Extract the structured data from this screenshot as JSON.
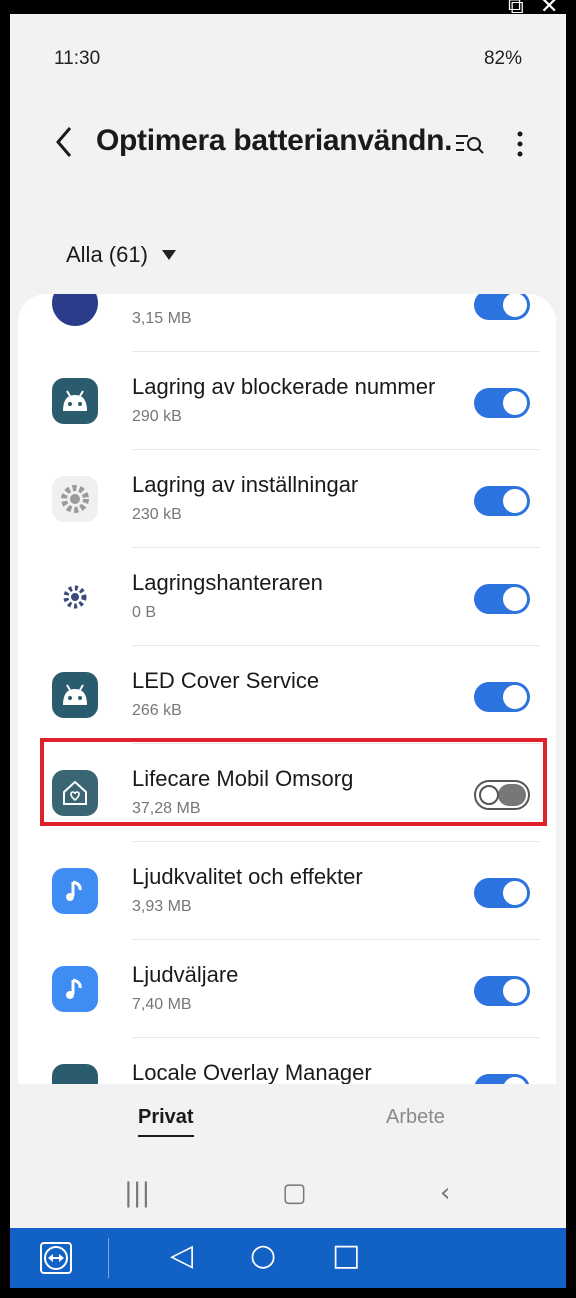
{
  "status_bar": {
    "time": "11:30",
    "right": "82%"
  },
  "header": {
    "title": "Optimera batterianvändn."
  },
  "filter": {
    "label": "Alla (61)"
  },
  "apps": [
    {
      "name": "",
      "size": "3,15 MB",
      "enabled": true,
      "icon": "android-app-icon"
    },
    {
      "name": "Lagring av blockerade nummer",
      "size": "290 kB",
      "enabled": true,
      "icon": "android-app-icon"
    },
    {
      "name": "Lagring av inställningar",
      "size": "230 kB",
      "enabled": true,
      "icon": "gear-icon"
    },
    {
      "name": "Lagringshanteraren",
      "size": "0 B",
      "enabled": true,
      "icon": "gear-icon"
    },
    {
      "name": "LED Cover Service",
      "size": "266 kB",
      "enabled": true,
      "icon": "android-app-icon"
    },
    {
      "name": "Lifecare Mobil Omsorg",
      "size": "37,28 MB",
      "enabled": false,
      "icon": "home-heart-icon"
    },
    {
      "name": "Ljudkvalitet och effekter",
      "size": "3,93 MB",
      "enabled": true,
      "icon": "music-note-icon"
    },
    {
      "name": "Ljudväljare",
      "size": "7,40 MB",
      "enabled": true,
      "icon": "music-note-icon"
    },
    {
      "name": "Locale Overlay Manager",
      "size": "",
      "enabled": true,
      "icon": "android-app-icon"
    }
  ],
  "tabs": {
    "private": "Privat",
    "work": "Arbete"
  },
  "colors": {
    "toggle_on": "#2c73e0",
    "highlight": "#e0202a",
    "android_icon": "#2b5b6e",
    "music_icon": "#3f8cf3",
    "remote_bar": "#1262c6"
  }
}
